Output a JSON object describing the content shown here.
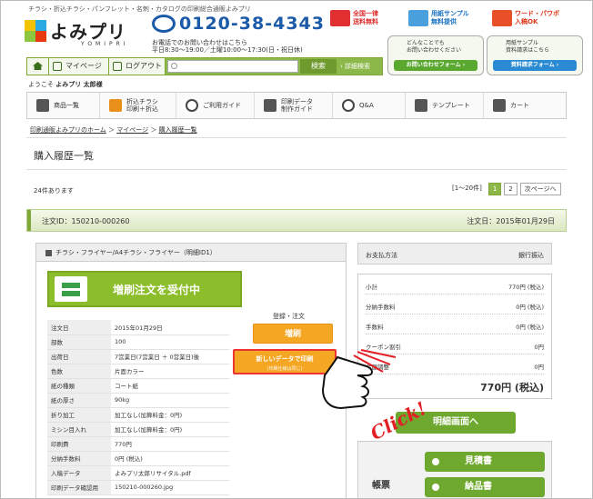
{
  "header": {
    "tagline": "チラシ・折込チラシ・パンフレット・名刺・カタログの印刷総合通販よみプリ",
    "logo_text": "よみプリ",
    "logo_sub": "YOMIPRI",
    "phone": "0120-38-4343",
    "phone_note1": "お電話でのお問い合わせはこちら",
    "phone_note2": "平日8:30〜19:00／土曜10:00〜17:30(日・祝日休)",
    "badges": [
      {
        "line1": "全国一律",
        "line2": "送料無料",
        "icon": "truck-icon"
      },
      {
        "line1": "用紙サンプル",
        "line2": "無料提供",
        "icon": "paper-sample-icon"
      },
      {
        "line1": "ワード・パワポ",
        "line2": "入稿OK",
        "icon": "word-powerpoint-icon"
      }
    ],
    "promos": [
      {
        "text1": "どんなことでも",
        "text2": "お問い合わせください",
        "button": "お問い合わせフォーム ›"
      },
      {
        "text1": "用紙サンプル",
        "text2": "資料請求はこちら",
        "button": "資料請求フォーム ›"
      }
    ]
  },
  "navbar": {
    "mypage": "マイページ",
    "logout": "ログアウト",
    "search_placeholder": "",
    "search_button": "検索",
    "advanced": "› 詳細検索"
  },
  "welcome": {
    "prefix": "ようこそ",
    "name": "よみプリ 太郎様"
  },
  "menu": [
    {
      "label": "商品一覧",
      "icon": "box-icon"
    },
    {
      "label": "折込チラシ\n印刷＋折込",
      "icon": "delivery-icon"
    },
    {
      "label": "ご利用ガイド",
      "icon": "info-icon"
    },
    {
      "label": "印刷データ\n制作ガイド",
      "icon": "document-icon"
    },
    {
      "label": "Q&A",
      "icon": "question-icon"
    },
    {
      "label": "テンプレート",
      "icon": "template-icon"
    },
    {
      "label": "カート",
      "icon": "cart-icon"
    }
  ],
  "breadcrumb": {
    "home": "印刷通販よみプリのホーム",
    "mypage": "マイページ",
    "current": "購入履歴一覧"
  },
  "page_title": "購入履歴一覧",
  "list": {
    "count": "24件あります",
    "range": "[1〜20件]",
    "pages": [
      "1",
      "2"
    ],
    "next": "次ページへ"
  },
  "order": {
    "id_label": "注文ID：150210-000260",
    "date_label": "注文日：2015年01月29日",
    "product_title": "チラシ・フライヤー/A4チラシ・フライヤー（明細ID1）",
    "banner_text": "増刷注文を受付中",
    "register_label": "登録・注文",
    "reorder_button": "増刷",
    "newdata_button": "新しいデータで印刷",
    "newdata_sub": "(印刷仕様は同じ)",
    "specs": [
      {
        "k": "注文日",
        "v": "2015年01月29日"
      },
      {
        "k": "部数",
        "v": "100"
      },
      {
        "k": "出荷日",
        "v": "7営業日(7営業日 ＋ 0営業日)後"
      },
      {
        "k": "色数",
        "v": "片面カラー"
      },
      {
        "k": "紙の種類",
        "v": "コート紙"
      },
      {
        "k": "紙の厚さ",
        "v": "90kg"
      },
      {
        "k": "折り加工",
        "v": "加工なし(加算料金：0円)"
      },
      {
        "k": "ミシン目入れ",
        "v": "加工なし(加算料金：0円)"
      },
      {
        "k": "印刷費",
        "v": "770円"
      },
      {
        "k": "分納手数料",
        "v": "0円 (税込)"
      },
      {
        "k": "入稿データ",
        "v": "よみプリ太郎リサイタル.pdf"
      },
      {
        "k": "印刷データ確認用",
        "v": "150210-000260.jpg"
      }
    ],
    "payment_label": "お支払方法",
    "payment_value": "銀行振込",
    "summary": [
      {
        "k": "小計",
        "v": "770円 (税込)"
      },
      {
        "k": "分納手数料",
        "v": "0円 (税込)"
      },
      {
        "k": "手数料",
        "v": "0円 (税込)"
      },
      {
        "k": "クーポン割引",
        "v": "0円"
      },
      {
        "k": "金額調整",
        "v": "0円"
      }
    ],
    "total": "770円 (税込)",
    "detail_button": "明細画面へ",
    "documents_label": "帳票",
    "estimate_button": "見積書",
    "delivery_button": "納品書",
    "click_text": "Click!"
  }
}
